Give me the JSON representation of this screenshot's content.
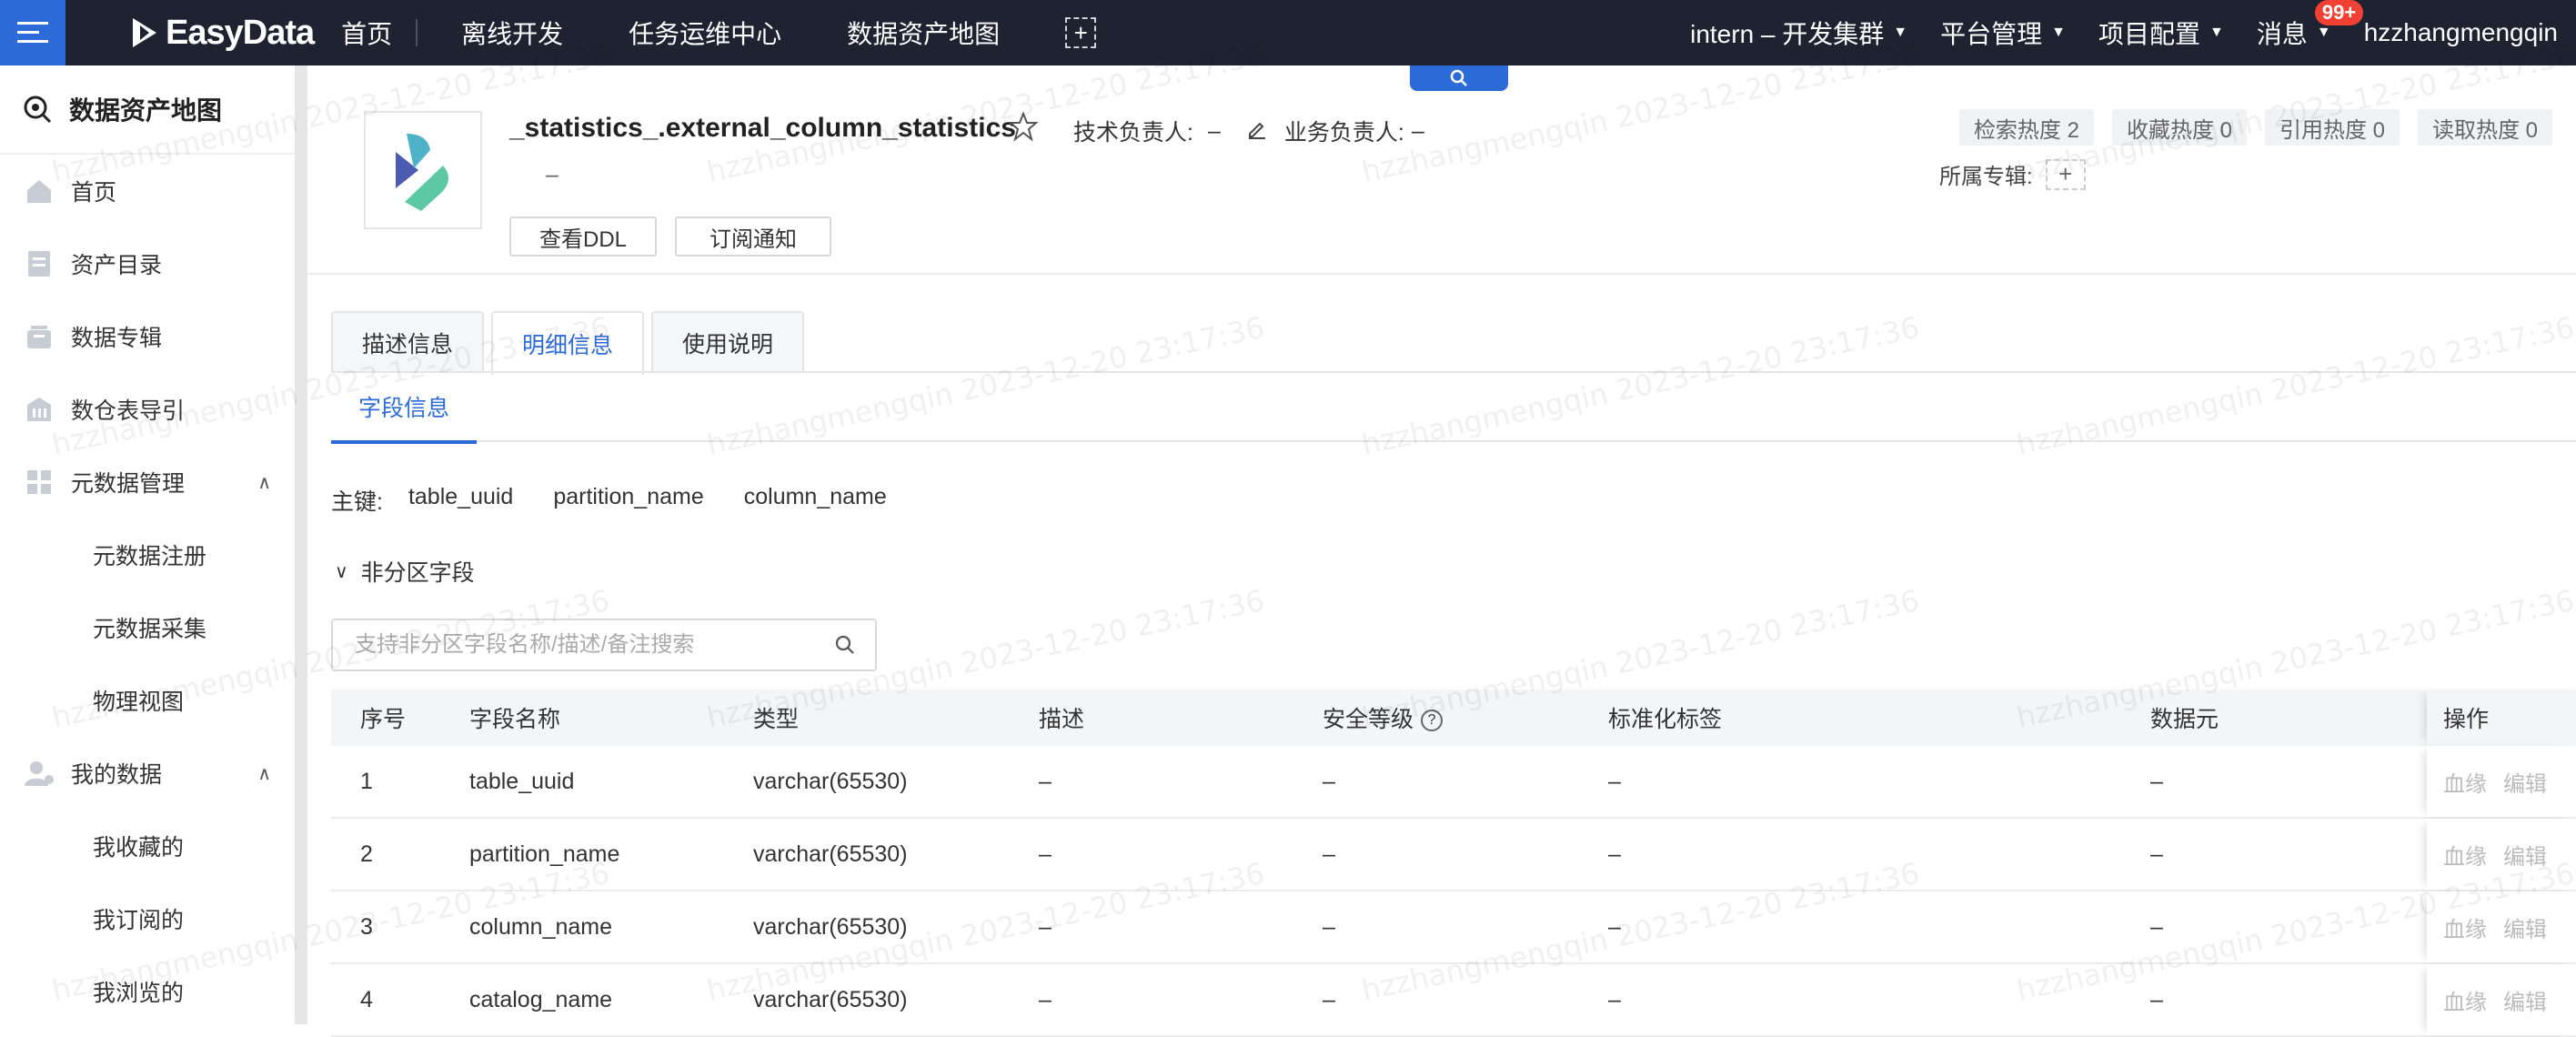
{
  "header": {
    "logo_text": "EasyData",
    "nav": [
      "首页",
      "离线开发",
      "任务运维中心",
      "数据资产地图"
    ],
    "add_icon": "plus-dashed-icon",
    "cluster": "intern – 开发集群",
    "platform": "平台管理",
    "project": "项目配置",
    "messages": "消息",
    "messages_badge": "99+",
    "user": "hzzhangmengqin"
  },
  "sidebar": {
    "title": "数据资产地图",
    "items": [
      {
        "label": "首页",
        "icon": "home-icon"
      },
      {
        "label": "资产目录",
        "icon": "catalog-icon"
      },
      {
        "label": "数据专辑",
        "icon": "album-icon"
      },
      {
        "label": "数仓表导引",
        "icon": "warehouse-icon"
      }
    ],
    "meta_group": {
      "label": "元数据管理",
      "icon": "grid-icon",
      "children": [
        "元数据注册",
        "元数据采集",
        "物理视图"
      ]
    },
    "my_group": {
      "label": "我的数据",
      "icon": "user-icon",
      "children": [
        "我收藏的",
        "我订阅的",
        "我浏览的"
      ]
    }
  },
  "detail": {
    "table_name": "_statistics_.external_column_statistics",
    "tech_owner_label": "技术负责人:",
    "tech_owner_value": "–",
    "biz_owner_label": "业务负责人:",
    "biz_owner_value": "–",
    "description": "–",
    "btn_ddl": "查看DDL",
    "btn_subscribe": "订阅通知",
    "stats": [
      "检索热度 2",
      "收藏热度 0",
      "引用热度 0",
      "读取热度 0"
    ],
    "album_label": "所属专辑:",
    "album_add": "+"
  },
  "tabs": [
    "描述信息",
    "明细信息",
    "使用说明"
  ],
  "active_tab": "明细信息",
  "subtab": "字段信息",
  "primary_key": {
    "label": "主键:",
    "fields": [
      "table_uuid",
      "partition_name",
      "column_name"
    ]
  },
  "section": "非分区字段",
  "search": {
    "placeholder": "支持非分区字段名称/描述/备注搜索"
  },
  "table": {
    "columns": [
      "序号",
      "字段名称",
      "类型",
      "描述",
      "安全等级",
      "标准化标签",
      "数据元",
      "操作"
    ],
    "rows": [
      [
        "1",
        "table_uuid",
        "varchar(65530)",
        "–",
        "–",
        "–",
        "–"
      ],
      [
        "2",
        "partition_name",
        "varchar(65530)",
        "–",
        "–",
        "–",
        "–"
      ],
      [
        "3",
        "column_name",
        "varchar(65530)",
        "–",
        "–",
        "–",
        "–"
      ],
      [
        "4",
        "catalog_name",
        "varchar(65530)",
        "–",
        "–",
        "–",
        "–"
      ]
    ],
    "ops": [
      "血缘",
      "编辑"
    ]
  },
  "watermark": {
    "user": "hzzhangmengqin",
    "time": "2023-12-20 23:17:36"
  },
  "colors": {
    "accent": "#2d6bd8",
    "topbar": "#1f2230",
    "badge": "#f04134"
  }
}
